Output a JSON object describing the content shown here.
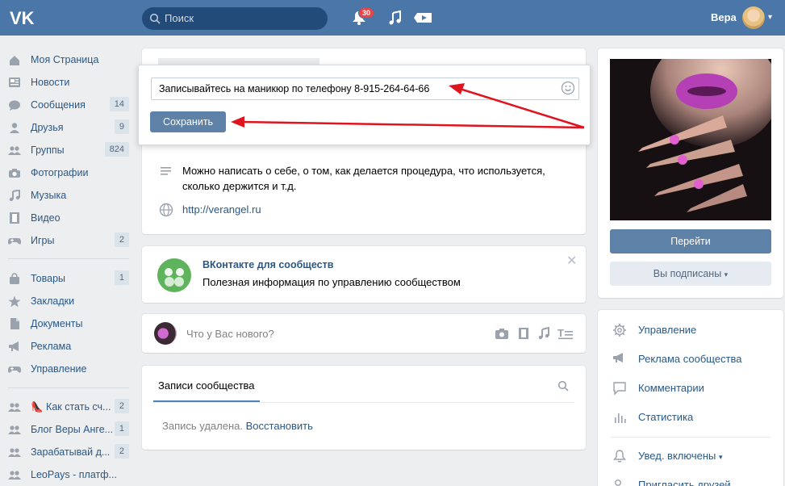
{
  "header": {
    "logo": "VK",
    "search_placeholder": "Поиск",
    "notifications_count": "30",
    "user_name": "Вера"
  },
  "sidebar": {
    "items": [
      {
        "label": "Моя Страница",
        "icon": "home-icon",
        "count": ""
      },
      {
        "label": "Новости",
        "icon": "news-icon",
        "count": ""
      },
      {
        "label": "Сообщения",
        "icon": "messages-icon",
        "count": "14"
      },
      {
        "label": "Друзья",
        "icon": "friends-icon",
        "count": "9"
      },
      {
        "label": "Группы",
        "icon": "groups-icon",
        "count": "824"
      },
      {
        "label": "Фотографии",
        "icon": "camera-icon",
        "count": ""
      },
      {
        "label": "Музыка",
        "icon": "music-icon",
        "count": ""
      },
      {
        "label": "Видео",
        "icon": "video-icon",
        "count": ""
      },
      {
        "label": "Игры",
        "icon": "gamepad-icon",
        "count": "2"
      },
      {
        "label": "Товары",
        "icon": "bag-icon",
        "count": "1"
      },
      {
        "label": "Закладки",
        "icon": "star-icon",
        "count": ""
      },
      {
        "label": "Документы",
        "icon": "document-icon",
        "count": ""
      },
      {
        "label": "Реклама",
        "icon": "megaphone-icon",
        "count": ""
      },
      {
        "label": "Управление",
        "icon": "gamepad-icon",
        "count": ""
      },
      {
        "label": "👠 Как стать сч...",
        "icon": "community-icon",
        "count": "2"
      },
      {
        "label": "Блог Веры Анге...",
        "icon": "community-icon",
        "count": "1"
      },
      {
        "label": "Зарабатывай д...",
        "icon": "community-icon",
        "count": "2"
      },
      {
        "label": "LeoPays - платф...",
        "icon": "community-icon",
        "count": ""
      }
    ]
  },
  "status_popup": {
    "input_value": "Записывайтесь на маникюр по телефону 8-915-264-64-66",
    "save_label": "Сохранить"
  },
  "info": {
    "description": "Можно написать о себе, о том, как делается процедура, что используется, сколько держится и т.д.",
    "website": "http://verangel.ru"
  },
  "promo": {
    "title": "ВКонтакте для сообществ",
    "text": "Полезная информация по управлению сообществом"
  },
  "composer": {
    "placeholder": "Что у Вас нового?"
  },
  "wall": {
    "tab": "Записи сообщества",
    "deleted_text": "Запись удалена.",
    "restore_link": "Восстановить"
  },
  "right": {
    "go_button": "Перейти",
    "subscribed_button": "Вы подписаны",
    "menu": [
      {
        "label": "Управление",
        "icon": "gear-icon"
      },
      {
        "label": "Реклама сообщества",
        "icon": "megaphone-icon"
      },
      {
        "label": "Комментарии",
        "icon": "comment-icon"
      },
      {
        "label": "Статистика",
        "icon": "stats-icon"
      }
    ],
    "notify": "Увед. включены",
    "invite": "Пригласить друзей"
  },
  "colors": {
    "header": "#4a76a8",
    "link": "#2a5885",
    "button": "#5e81a8",
    "arrow": "#e0141e"
  }
}
